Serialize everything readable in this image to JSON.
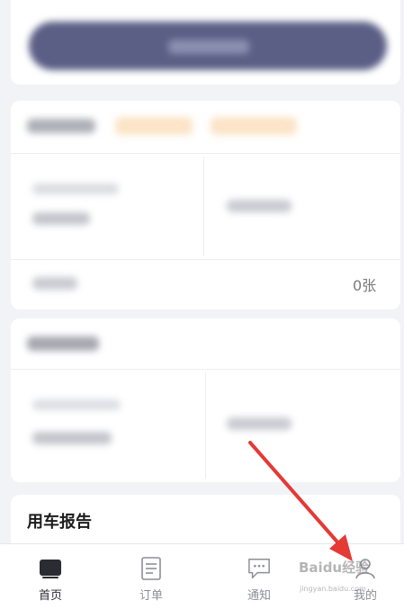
{
  "side_text": "0张",
  "report": {
    "title": "用车报告"
  },
  "tabbar": {
    "tabs": [
      {
        "label": "首页",
        "icon": "home-icon",
        "active": true
      },
      {
        "label": "订单",
        "icon": "orders-icon",
        "active": false
      },
      {
        "label": "通知",
        "icon": "notification-icon",
        "active": false
      },
      {
        "label": "我的",
        "icon": "profile-icon",
        "active": false
      }
    ]
  },
  "watermark": {
    "text": "Baidu经验",
    "sub": "jingyan.baidu.com"
  },
  "colors": {
    "button": "#5b5f86",
    "arrow": "#e53935",
    "active_tab": "#2b2b33",
    "inactive_tab": "#8d8f96"
  }
}
